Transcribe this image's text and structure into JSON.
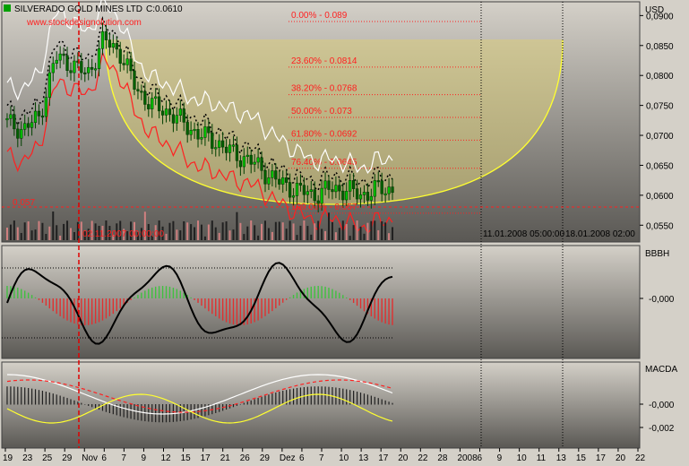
{
  "header": {
    "title": "SILVERADO GOLD MINES LTD",
    "close_label": "C:0.0610",
    "watermark": "www.stockdesignolution.com"
  },
  "price_panel": {
    "unit": "USD",
    "y_ticks": [
      "0,0900",
      "0,0850",
      "0,0800",
      "0,0750",
      "0,0700",
      "0,0650",
      "0,0600",
      "0,0550"
    ],
    "ylim": [
      0.0525,
      0.092
    ],
    "fib_labels": [
      "0.00% - 0.089",
      "23.60% - 0.0814",
      "38.20% - 0.0768",
      "50.00% - 0.073",
      "61.80% - 0.0692",
      "76.40% - 0.0645",
      "100.00% - 0.057"
    ],
    "fib_levels": [
      0.089,
      0.0814,
      0.0768,
      0.073,
      0.0692,
      0.0645,
      0.057
    ],
    "low_label": "0.057",
    "cursor_label": "02.11.2007 00:00:00",
    "vline_labels": [
      "11.01.2008 05:00:00",
      "18.01.2008 02:00"
    ]
  },
  "indicators": {
    "bbbh": {
      "name": "BBBH",
      "y_ticks": [
        "-0,000"
      ]
    },
    "macda": {
      "name": "MACDA",
      "y_ticks": [
        "-0,000",
        "-0,002"
      ]
    }
  },
  "x_axis": {
    "labels": [
      "19",
      "23",
      "25",
      "29",
      "Nov",
      "6",
      "7",
      "9",
      "12",
      "15",
      "17",
      "21",
      "26",
      "29",
      "Dez",
      "6",
      "7",
      "10",
      "13",
      "17",
      "20",
      "22",
      "28",
      "2008",
      "6",
      "9",
      "10",
      "11",
      "13",
      "15",
      "17",
      "20",
      "22"
    ]
  },
  "colors": {
    "background": "#d4d0c8",
    "candle_up": "#00c000",
    "candle_down": "#006000",
    "fib": "#ff2020",
    "arc": "#ffff30",
    "upper_band": "#ffffff",
    "lower_band": "#ff2020",
    "moving_average": "#000000",
    "cursor": "#e00000"
  },
  "chart_data": [
    {
      "type": "candlestick",
      "title": "SILVERADO GOLD MINES LTD",
      "ylabel": "USD",
      "ylim": [
        0.0525,
        0.092
      ],
      "x": [
        "19",
        "23",
        "25",
        "29",
        "Nov",
        "6",
        "7",
        "9",
        "12",
        "15",
        "17",
        "21",
        "26",
        "29",
        "Dez",
        "6",
        "7",
        "10",
        "13",
        "17",
        "20",
        "22",
        "28",
        "2008",
        "6"
      ],
      "close": [
        0.072,
        0.071,
        0.073,
        0.083,
        0.082,
        0.08,
        0.086,
        0.084,
        0.078,
        0.075,
        0.074,
        0.072,
        0.07,
        0.069,
        0.067,
        0.066,
        0.064,
        0.062,
        0.061,
        0.06,
        0.061,
        0.061,
        0.06,
        0.061,
        0.061
      ],
      "fib_levels": [
        0.089,
        0.0814,
        0.0768,
        0.073,
        0.0692,
        0.0645,
        0.057
      ]
    },
    {
      "type": "line",
      "title": "BBBH",
      "series": []
    },
    {
      "type": "line",
      "title": "MACDA",
      "y_ticks": [
        "-0,000",
        "-0,002"
      ],
      "series": []
    }
  ]
}
